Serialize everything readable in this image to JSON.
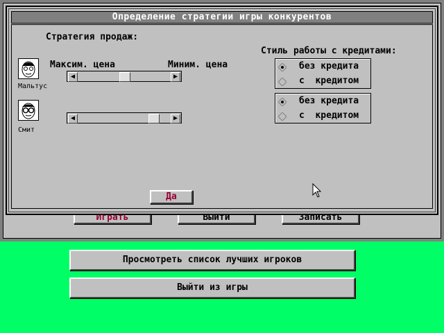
{
  "dialog": {
    "title": "Определение стратегии игры конкурентов",
    "sales_strategy_label": "Стратегия продаж:",
    "max_price_label": "Максим. цена",
    "min_price_label": "Миним. цена",
    "credit_style_label": "Стиль работы с кредитами:",
    "ok_button": "Да",
    "competitors": [
      {
        "name": "Мальтус",
        "icon": "face-icon",
        "price_slider_level": 0.5
      },
      {
        "name": "Смит",
        "icon": "face-glasses-icon",
        "price_slider_level": 0.85
      }
    ],
    "credit_groups": [
      {
        "options": [
          "без кредита",
          "с  кредитом"
        ],
        "selected": 0
      },
      {
        "options": [
          "без кредита",
          "с  кредитом"
        ],
        "selected": 0
      }
    ]
  },
  "background_window": {
    "buttons": [
      "Играть",
      "Выйти",
      "Записать"
    ]
  },
  "main_menu": {
    "buttons": [
      "Просмотреть список лучших игроков",
      "Выйти из игры"
    ]
  },
  "colors": {
    "background": "#00ff66",
    "window": "#c0c0c0",
    "title_bar": "#808080",
    "accent_text": "#990033"
  }
}
